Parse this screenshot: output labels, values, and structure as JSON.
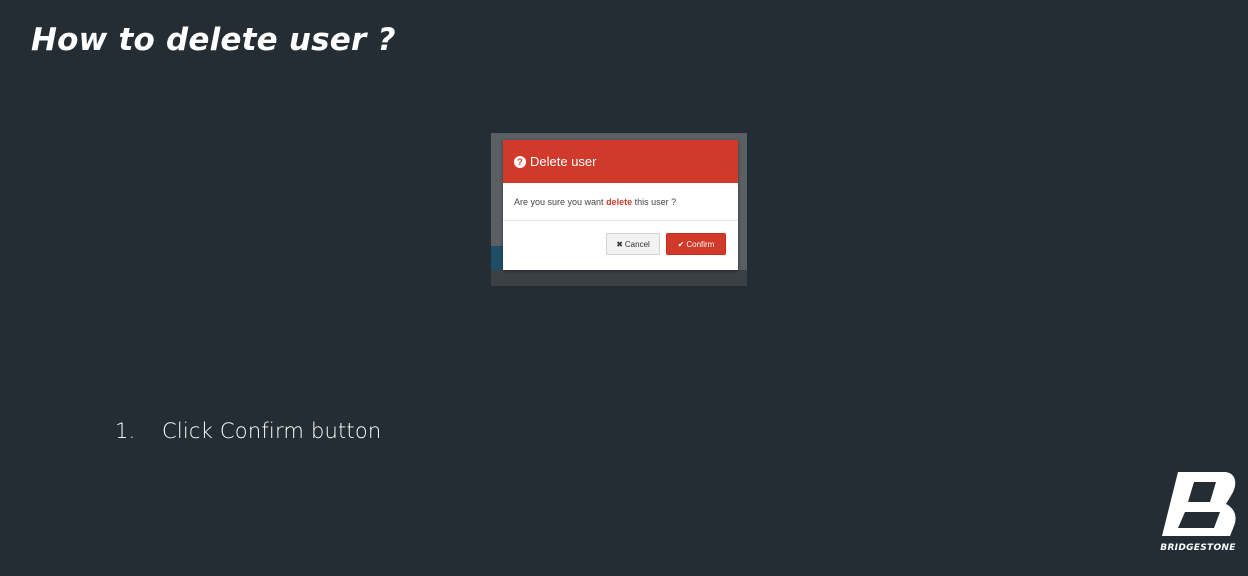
{
  "slide": {
    "title": "How to delete user ?",
    "step_number": "1.",
    "step_text": "Click Confirm button"
  },
  "dialog": {
    "title": "Delete user",
    "message_prefix": "Are you sure you want ",
    "message_emphasis": "delete",
    "message_suffix": " this user ?",
    "close_glyph": "×",
    "cancel_label": "Cancel",
    "confirm_label": "Confirm",
    "header_color": "#d13a2a"
  },
  "logo": {
    "wordmark": "BRIDGESTONE"
  }
}
